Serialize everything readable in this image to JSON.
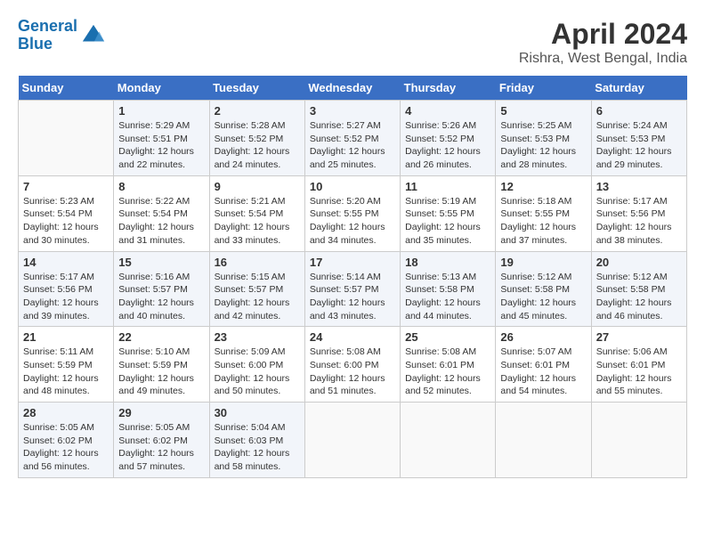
{
  "header": {
    "logo_line1": "General",
    "logo_line2": "Blue",
    "title": "April 2024",
    "subtitle": "Rishra, West Bengal, India"
  },
  "columns": [
    "Sunday",
    "Monday",
    "Tuesday",
    "Wednesday",
    "Thursday",
    "Friday",
    "Saturday"
  ],
  "weeks": [
    [
      {
        "day": "",
        "info": ""
      },
      {
        "day": "1",
        "info": "Sunrise: 5:29 AM\nSunset: 5:51 PM\nDaylight: 12 hours\nand 22 minutes."
      },
      {
        "day": "2",
        "info": "Sunrise: 5:28 AM\nSunset: 5:52 PM\nDaylight: 12 hours\nand 24 minutes."
      },
      {
        "day": "3",
        "info": "Sunrise: 5:27 AM\nSunset: 5:52 PM\nDaylight: 12 hours\nand 25 minutes."
      },
      {
        "day": "4",
        "info": "Sunrise: 5:26 AM\nSunset: 5:52 PM\nDaylight: 12 hours\nand 26 minutes."
      },
      {
        "day": "5",
        "info": "Sunrise: 5:25 AM\nSunset: 5:53 PM\nDaylight: 12 hours\nand 28 minutes."
      },
      {
        "day": "6",
        "info": "Sunrise: 5:24 AM\nSunset: 5:53 PM\nDaylight: 12 hours\nand 29 minutes."
      }
    ],
    [
      {
        "day": "7",
        "info": "Sunrise: 5:23 AM\nSunset: 5:54 PM\nDaylight: 12 hours\nand 30 minutes."
      },
      {
        "day": "8",
        "info": "Sunrise: 5:22 AM\nSunset: 5:54 PM\nDaylight: 12 hours\nand 31 minutes."
      },
      {
        "day": "9",
        "info": "Sunrise: 5:21 AM\nSunset: 5:54 PM\nDaylight: 12 hours\nand 33 minutes."
      },
      {
        "day": "10",
        "info": "Sunrise: 5:20 AM\nSunset: 5:55 PM\nDaylight: 12 hours\nand 34 minutes."
      },
      {
        "day": "11",
        "info": "Sunrise: 5:19 AM\nSunset: 5:55 PM\nDaylight: 12 hours\nand 35 minutes."
      },
      {
        "day": "12",
        "info": "Sunrise: 5:18 AM\nSunset: 5:55 PM\nDaylight: 12 hours\nand 37 minutes."
      },
      {
        "day": "13",
        "info": "Sunrise: 5:17 AM\nSunset: 5:56 PM\nDaylight: 12 hours\nand 38 minutes."
      }
    ],
    [
      {
        "day": "14",
        "info": "Sunrise: 5:17 AM\nSunset: 5:56 PM\nDaylight: 12 hours\nand 39 minutes."
      },
      {
        "day": "15",
        "info": "Sunrise: 5:16 AM\nSunset: 5:57 PM\nDaylight: 12 hours\nand 40 minutes."
      },
      {
        "day": "16",
        "info": "Sunrise: 5:15 AM\nSunset: 5:57 PM\nDaylight: 12 hours\nand 42 minutes."
      },
      {
        "day": "17",
        "info": "Sunrise: 5:14 AM\nSunset: 5:57 PM\nDaylight: 12 hours\nand 43 minutes."
      },
      {
        "day": "18",
        "info": "Sunrise: 5:13 AM\nSunset: 5:58 PM\nDaylight: 12 hours\nand 44 minutes."
      },
      {
        "day": "19",
        "info": "Sunrise: 5:12 AM\nSunset: 5:58 PM\nDaylight: 12 hours\nand 45 minutes."
      },
      {
        "day": "20",
        "info": "Sunrise: 5:12 AM\nSunset: 5:58 PM\nDaylight: 12 hours\nand 46 minutes."
      }
    ],
    [
      {
        "day": "21",
        "info": "Sunrise: 5:11 AM\nSunset: 5:59 PM\nDaylight: 12 hours\nand 48 minutes."
      },
      {
        "day": "22",
        "info": "Sunrise: 5:10 AM\nSunset: 5:59 PM\nDaylight: 12 hours\nand 49 minutes."
      },
      {
        "day": "23",
        "info": "Sunrise: 5:09 AM\nSunset: 6:00 PM\nDaylight: 12 hours\nand 50 minutes."
      },
      {
        "day": "24",
        "info": "Sunrise: 5:08 AM\nSunset: 6:00 PM\nDaylight: 12 hours\nand 51 minutes."
      },
      {
        "day": "25",
        "info": "Sunrise: 5:08 AM\nSunset: 6:01 PM\nDaylight: 12 hours\nand 52 minutes."
      },
      {
        "day": "26",
        "info": "Sunrise: 5:07 AM\nSunset: 6:01 PM\nDaylight: 12 hours\nand 54 minutes."
      },
      {
        "day": "27",
        "info": "Sunrise: 5:06 AM\nSunset: 6:01 PM\nDaylight: 12 hours\nand 55 minutes."
      }
    ],
    [
      {
        "day": "28",
        "info": "Sunrise: 5:05 AM\nSunset: 6:02 PM\nDaylight: 12 hours\nand 56 minutes."
      },
      {
        "day": "29",
        "info": "Sunrise: 5:05 AM\nSunset: 6:02 PM\nDaylight: 12 hours\nand 57 minutes."
      },
      {
        "day": "30",
        "info": "Sunrise: 5:04 AM\nSunset: 6:03 PM\nDaylight: 12 hours\nand 58 minutes."
      },
      {
        "day": "",
        "info": ""
      },
      {
        "day": "",
        "info": ""
      },
      {
        "day": "",
        "info": ""
      },
      {
        "day": "",
        "info": ""
      }
    ]
  ]
}
